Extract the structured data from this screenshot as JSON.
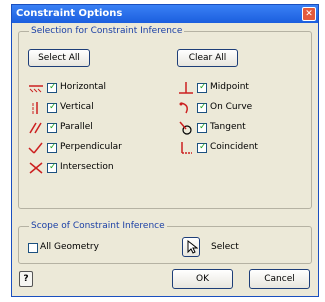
{
  "window": {
    "title": "Constraint Options",
    "close_symbol": "✕"
  },
  "selection_group": {
    "legend": "Selection for Constraint Inference",
    "select_all_label": "Select All",
    "clear_all_label": "Clear All",
    "items_left": [
      {
        "label": "Horizontal",
        "checked": true,
        "icon": "horizontal-constraint-icon"
      },
      {
        "label": "Vertical",
        "checked": true,
        "icon": "vertical-constraint-icon"
      },
      {
        "label": "Parallel",
        "checked": true,
        "icon": "parallel-constraint-icon"
      },
      {
        "label": "Perpendicular",
        "checked": true,
        "icon": "perpendicular-constraint-icon"
      },
      {
        "label": "Intersection",
        "checked": true,
        "icon": "intersection-constraint-icon"
      }
    ],
    "items_right": [
      {
        "label": "Midpoint",
        "checked": true,
        "icon": "midpoint-constraint-icon"
      },
      {
        "label": "On Curve",
        "checked": true,
        "icon": "on-curve-constraint-icon"
      },
      {
        "label": "Tangent",
        "checked": true,
        "icon": "tangent-constraint-icon"
      },
      {
        "label": "Coincident",
        "checked": true,
        "icon": "coincident-constraint-icon"
      }
    ]
  },
  "scope_group": {
    "legend": "Scope of Constraint Inference",
    "all_geometry_label": "All Geometry",
    "all_geometry_checked": false,
    "select_label": "Select"
  },
  "footer": {
    "help_symbol": "?",
    "ok_label": "OK",
    "cancel_label": "Cancel"
  },
  "colors": {
    "title_bar": "#1b5ede",
    "legend_text": "#1a3fa5",
    "icon_red": "#cc2020",
    "check_green": "#21a121",
    "dialog_bg": "#ece9d8"
  }
}
